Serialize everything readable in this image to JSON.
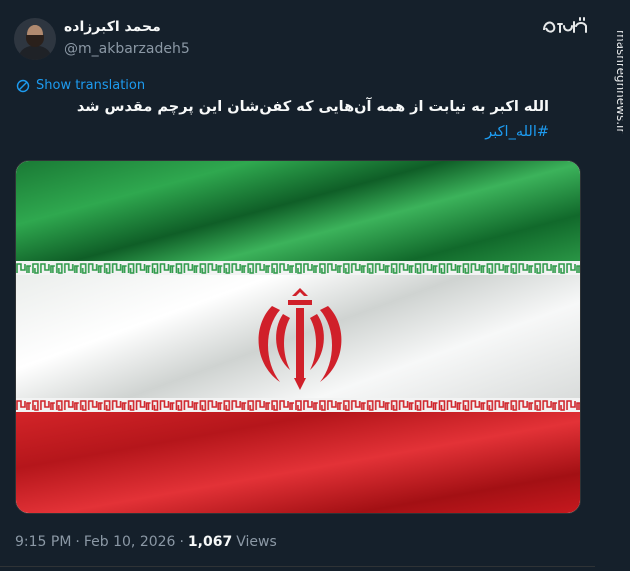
{
  "author": {
    "name": "محمد اکبرزاده",
    "handle": "@m_akbarzadeh5"
  },
  "logo": {
    "icon": "mashregh-logo-icon"
  },
  "translate": {
    "label": "Show translation",
    "icon": "translate-icon"
  },
  "tweet": {
    "text": "الله اکبر به نیابت از همه آن‌هایی که کفن‌شان این پرچم مقدس شد",
    "hashtag": "#الله_اکبر"
  },
  "media": {
    "icon": "iran-flag-image"
  },
  "meta": {
    "time": "9:15 PM",
    "separator": "·",
    "date": "Feb 10, 2026",
    "separator2": "·",
    "views_count": "1,067",
    "views_label": "Views"
  },
  "watermark": {
    "text": "mashreghnews.ir"
  },
  "colors": {
    "background": "#15202b",
    "link": "#1d9bf0",
    "muted": "#8b98a5",
    "flag_green": "#239f40",
    "flag_red": "#da0000"
  }
}
